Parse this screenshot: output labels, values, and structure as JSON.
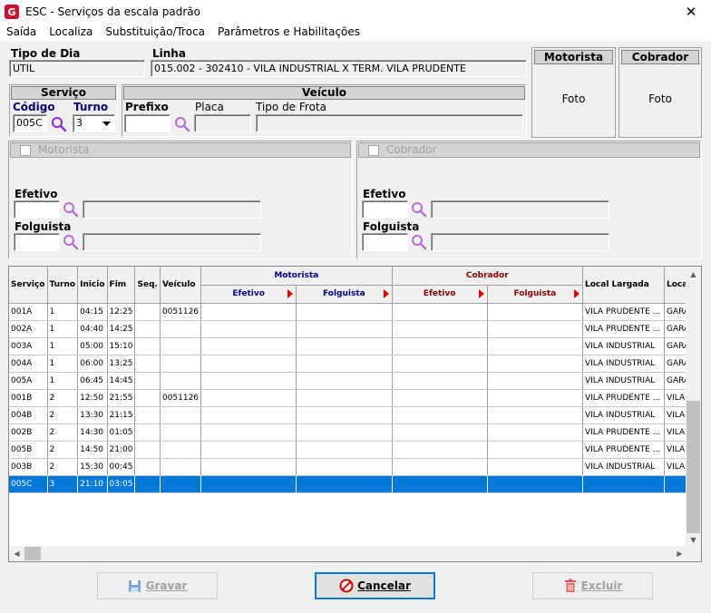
{
  "window": {
    "title": "ESC - Serviços da escala padrão",
    "logo": "G",
    "close": "✕"
  },
  "menu": [
    "Saída",
    "Localiza",
    "Substituição/Troca",
    "Parâmetros e Habilitações"
  ],
  "tipo_dia": {
    "label": "Tipo de Dia",
    "value": "UTIL"
  },
  "linha": {
    "label": "Linha",
    "value": "015.002 - 302410 - VILA INDUSTRIAL X TERM. VILA PRUDENTE"
  },
  "motorista_photo": {
    "title": "Motorista",
    "caption": "Foto"
  },
  "cobrador_photo": {
    "title": "Cobrador",
    "caption": "Foto"
  },
  "servico": {
    "title": "Serviço",
    "codigo_label": "Código",
    "codigo_value": "005C",
    "turno_label": "Turno",
    "turno_value": "3"
  },
  "veiculo": {
    "title": "Veículo",
    "prefixo_label": "Prefixo",
    "placa_label": "Placa",
    "tipo_frota_label": "Tipo de Frota"
  },
  "motorista_group": {
    "title": "Motorista",
    "efetivo_label": "Efetivo",
    "folguista_label": "Folguista"
  },
  "cobrador_group": {
    "title": "Cobrador",
    "efetivo_label": "Efetivo",
    "folguista_label": "Folguista"
  },
  "grid": {
    "headers": {
      "servico": "Serviço",
      "turno": "Turno",
      "inicio": "Inicio",
      "fim": "Fim",
      "seq": "Seq.",
      "veiculo": "Veículo",
      "motorista": "Motorista",
      "cobrador": "Cobrador",
      "efetivo": "Efetivo",
      "folguista": "Folguista",
      "local_largada": "Local Largada",
      "local2": "Local"
    },
    "rows": [
      [
        "001A",
        "1",
        "04:15",
        "12:25",
        "",
        "0051126",
        "",
        "",
        "",
        "",
        "VILA PRUDENTE ...",
        "GARAG"
      ],
      [
        "002A",
        "1",
        "04:40",
        "14:25",
        "",
        "",
        "",
        "",
        "",
        "",
        "VILA PRUDENTE ...",
        "GARAG"
      ],
      [
        "003A",
        "1",
        "05:00",
        "15:10",
        "",
        "",
        "",
        "",
        "",
        "",
        "VILA INDUSTRIAL",
        "GARAG"
      ],
      [
        "004A",
        "1",
        "06:00",
        "13:25",
        "",
        "",
        "",
        "",
        "",
        "",
        "VILA INDUSTRIAL",
        "GARAG"
      ],
      [
        "005A",
        "1",
        "06:45",
        "14:45",
        "",
        "",
        "",
        "",
        "",
        "",
        "VILA INDUSTRIAL",
        "GARAG"
      ],
      [
        "001B",
        "2",
        "12:50",
        "21:55",
        "",
        "0051126",
        "",
        "",
        "",
        "",
        "VILA PRUDENTE ...",
        "VILA IN"
      ],
      [
        "004B",
        "2",
        "13:30",
        "21:15",
        "",
        "",
        "",
        "",
        "",
        "",
        "VILA INDUSTRIAL",
        "VILA IN"
      ],
      [
        "002B",
        "2",
        "14:30",
        "01:05",
        "",
        "",
        "",
        "",
        "",
        "",
        "VILA PRUDENTE ...",
        "VILA IN"
      ],
      [
        "005B",
        "2",
        "14:50",
        "21:00",
        "",
        "",
        "",
        "",
        "",
        "",
        "VILA PRUDENTE ...",
        "VILA IN"
      ],
      [
        "003B",
        "2",
        "15:30",
        "00:45",
        "",
        "",
        "",
        "",
        "",
        "",
        "VILA INDUSTRIAL",
        "VILA IN"
      ],
      [
        "005C",
        "3",
        "21:10",
        "03:05",
        "",
        "",
        "",
        "",
        "",
        "",
        "",
        ""
      ]
    ],
    "selected_index": 10
  },
  "buttons": {
    "gravar": "Gravar",
    "cancelar": "Cancelar",
    "excluir": "Excluir"
  },
  "colors": {
    "selection": "#0078d7",
    "motorista_header": "#00008b",
    "cobrador_header": "#8b0000",
    "logo": "#c8102e"
  }
}
